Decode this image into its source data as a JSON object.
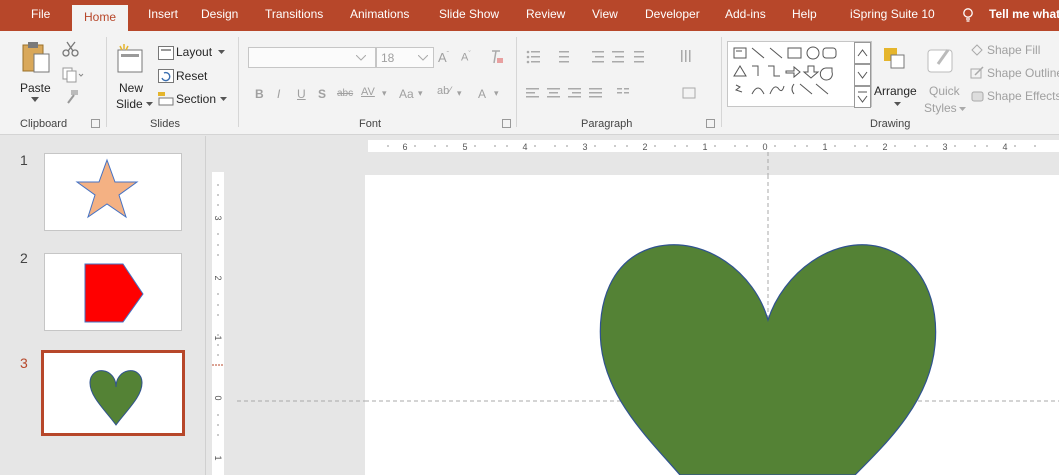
{
  "tabs": [
    {
      "label": "File",
      "active": false
    },
    {
      "label": "Home",
      "active": true
    },
    {
      "label": "Insert",
      "active": false
    },
    {
      "label": "Design",
      "active": false
    },
    {
      "label": "Transitions",
      "active": false
    },
    {
      "label": "Animations",
      "active": false
    },
    {
      "label": "Slide Show",
      "active": false
    },
    {
      "label": "Review",
      "active": false
    },
    {
      "label": "View",
      "active": false
    },
    {
      "label": "Developer",
      "active": false
    },
    {
      "label": "Add-ins",
      "active": false
    },
    {
      "label": "Help",
      "active": false
    },
    {
      "label": "iSpring Suite 10",
      "active": false
    }
  ],
  "tell_me": "Tell me what",
  "ribbon": {
    "clipboard": {
      "paste": "Paste",
      "group": "Clipboard"
    },
    "slides": {
      "new_slide_1": "New",
      "new_slide_2": "Slide",
      "layout": "Layout",
      "reset": "Reset",
      "section": "Section",
      "group": "Slides"
    },
    "font": {
      "size": "18",
      "change_case": "Aa",
      "group": "Font"
    },
    "paragraph": {
      "group": "Paragraph"
    },
    "drawing": {
      "arrange": "Arrange",
      "quick_1": "Quick",
      "quick_2": "Styles",
      "shape_fill": "Shape Fill",
      "shape_outline": "Shape Outline",
      "shape_effects": "Shape Effects",
      "group": "Drawing"
    }
  },
  "ruler": {
    "h_ticks": [
      "6",
      "5",
      "4",
      "3",
      "2",
      "1",
      "0",
      "1",
      "2",
      "3",
      "4"
    ],
    "v_ticks": [
      "3",
      "2",
      "1",
      "0",
      "1"
    ]
  },
  "slides": [
    {
      "number": "1",
      "shape": "star",
      "fill": "#f4b183",
      "selected": false
    },
    {
      "number": "2",
      "shape": "pentagon-arrow",
      "fill": "#ff0000",
      "selected": false
    },
    {
      "number": "3",
      "shape": "heart",
      "fill": "#548235",
      "selected": true
    }
  ],
  "canvas": {
    "shape": "heart",
    "fill": "#548235",
    "stroke": "#2f528f"
  },
  "colors": {
    "accent": "#b7472a",
    "ribbon_bg": "#f3f3f3",
    "workspace_bg": "#e6e6e6"
  }
}
